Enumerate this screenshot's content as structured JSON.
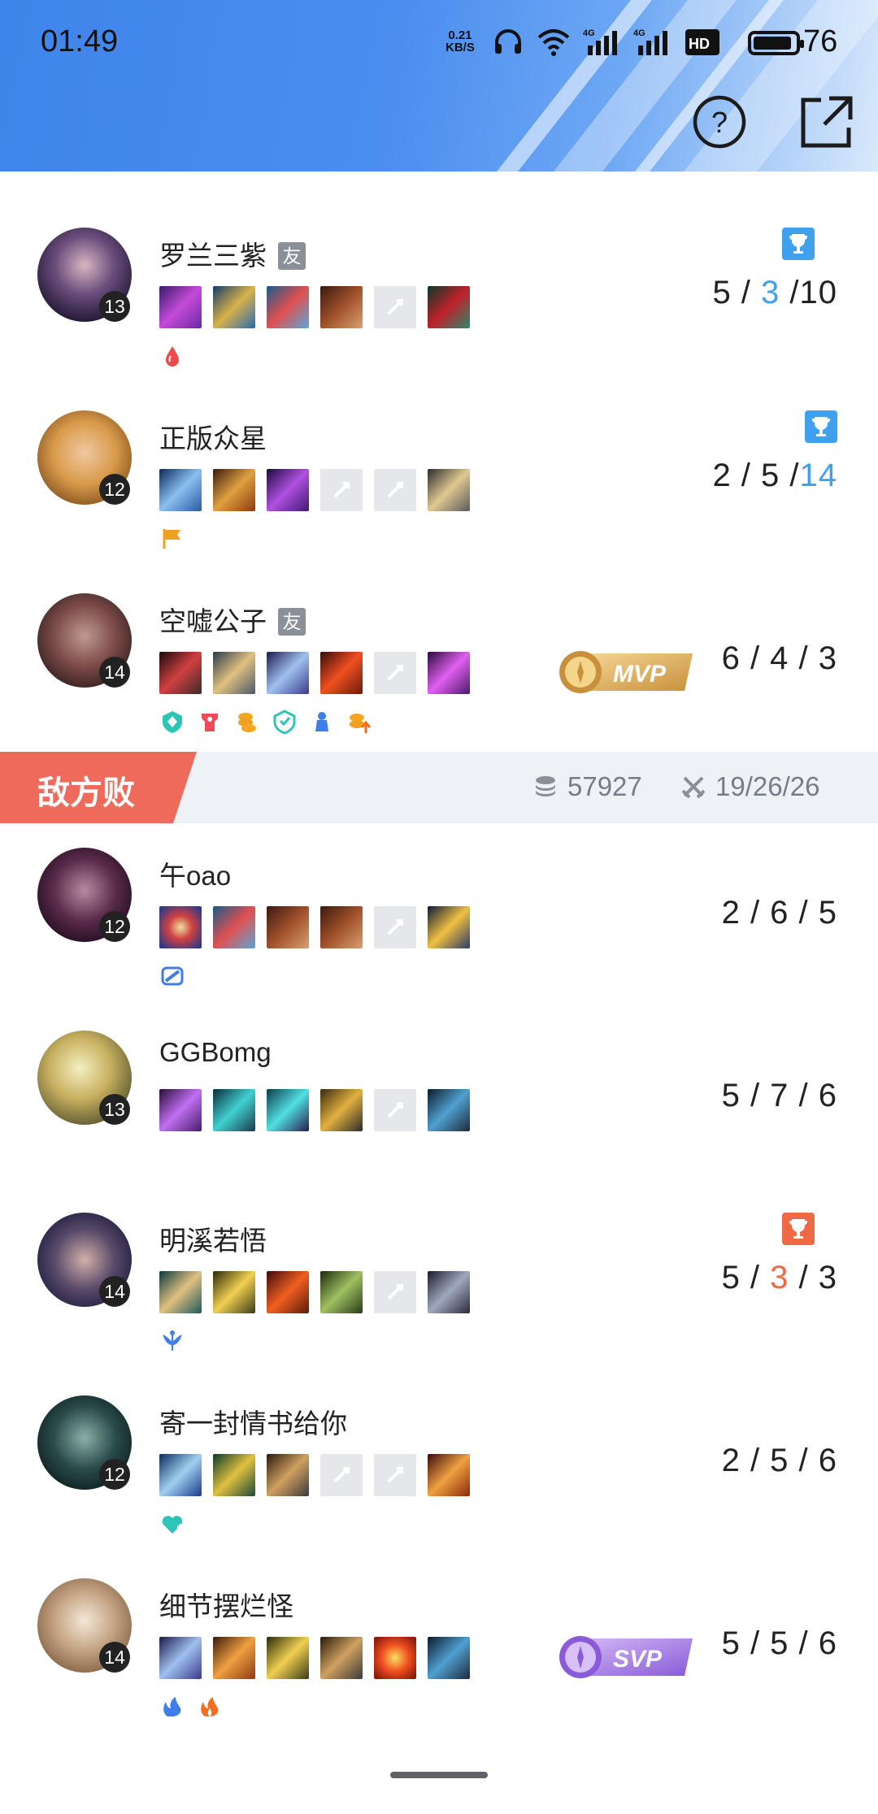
{
  "status_bar": {
    "time": "01:49",
    "net_speed_value": "0.21",
    "net_speed_unit": "KB/S",
    "battery": "76"
  },
  "header": {
    "help_icon": "question-circle-icon",
    "share_icon": "external-link-icon",
    "accent": "#4b8ef0"
  },
  "team_banner": {
    "result": "敌方败",
    "gold": "57927",
    "kda": "19/26/26",
    "tag_color": "#ee6a5a"
  },
  "ally_players": [
    {
      "name": "罗兰三紫",
      "friend_tag": "友",
      "level": "13",
      "k": "5 / ",
      "d": "3",
      "a": " /10",
      "trophy": "blue"
    },
    {
      "name": "正版众星",
      "friend_tag": "",
      "level": "12",
      "k": "2 / 5 /",
      "d": "",
      "a": "14",
      "trophy": "blue"
    },
    {
      "name": "空嘘公子",
      "friend_tag": "友",
      "level": "14",
      "k": "6 / 4 / 3",
      "d": "",
      "a": "",
      "award": "MVP"
    }
  ],
  "enemy_players": [
    {
      "name": "午oao",
      "level": "12",
      "k": "2 / 6 / 5",
      "d": "",
      "a": ""
    },
    {
      "name": "GGBomg",
      "level": "13",
      "k": "5 / 7 / 6",
      "d": "",
      "a": ""
    },
    {
      "name": "明溪若悟",
      "level": "14",
      "k": "5 / ",
      "d": "3",
      "a": " / 3",
      "trophy": "orange"
    },
    {
      "name": "寄一封情书给你",
      "level": "12",
      "k": "2 / 5 / 6",
      "d": "",
      "a": ""
    },
    {
      "name": "细节摆烂怪",
      "level": "14",
      "k": "5 / 5 / 6",
      "d": "",
      "a": "",
      "award": "SVP"
    }
  ]
}
